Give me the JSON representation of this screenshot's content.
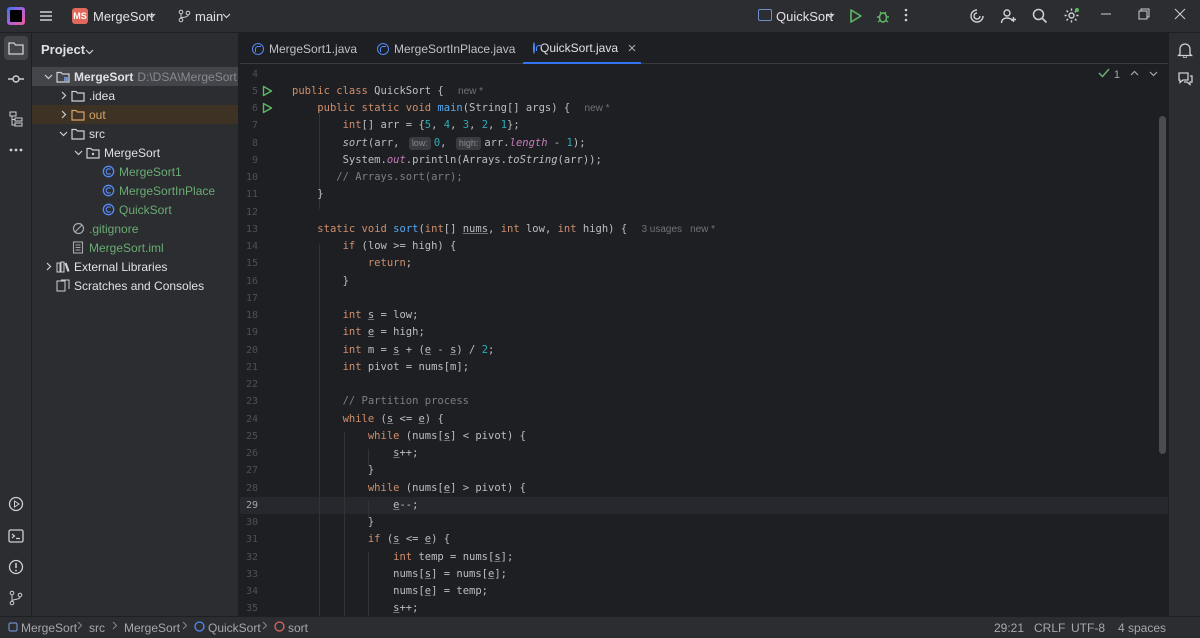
{
  "titlebar": {
    "project_badge": "MS",
    "project_name": "MergeSort",
    "branch": "main",
    "run_config": "QuickSort"
  },
  "project_panel": {
    "title": "Project",
    "tree": [
      {
        "label": "MergeSort",
        "path": "D:\\DSA\\MergeSort",
        "depth": 0,
        "arrow": "down",
        "icon": "module-folder-icon",
        "style": "bold",
        "selected": true
      },
      {
        "label": ".idea",
        "depth": 1,
        "arrow": "right",
        "icon": "folder-icon"
      },
      {
        "label": "out",
        "depth": 1,
        "arrow": "right",
        "icon": "folder-orange-icon",
        "style": "orange",
        "excluded": true
      },
      {
        "label": "src",
        "depth": 1,
        "arrow": "down",
        "icon": "folder-icon"
      },
      {
        "label": "MergeSort",
        "depth": 2,
        "arrow": "down",
        "icon": "package-icon"
      },
      {
        "label": "MergeSort1",
        "depth": 3,
        "icon": "class-icon",
        "style": "green"
      },
      {
        "label": "MergeSortInPlace",
        "depth": 3,
        "icon": "class-icon",
        "style": "green"
      },
      {
        "label": "QuickSort",
        "depth": 3,
        "icon": "class-icon",
        "style": "green"
      },
      {
        "label": ".gitignore",
        "depth": 1,
        "icon": "ignore-file-icon",
        "style": "green"
      },
      {
        "label": "MergeSort.iml",
        "depth": 1,
        "icon": "iml-file-icon",
        "style": "green"
      },
      {
        "label": "External Libraries",
        "depth": 0,
        "arrow": "right",
        "icon": "library-icon"
      },
      {
        "label": "Scratches and Consoles",
        "depth": 0,
        "icon": "scratches-icon"
      }
    ]
  },
  "editor_tabs": [
    {
      "label": "MergeSort1.java",
      "active": false
    },
    {
      "label": "MergeSortInPlace.java",
      "active": false
    },
    {
      "label": "QuickSort.java",
      "active": true
    }
  ],
  "editor": {
    "inspection_count": "1",
    "current_line": 29,
    "lines": [
      {
        "n": 4,
        "html": ""
      },
      {
        "n": 5,
        "run": true,
        "html": "<span class=\"kw\">public class</span> QuickSort { <span class=\"meta\">new *</span>"
      },
      {
        "n": 6,
        "run": true,
        "html": "    <span class=\"kw\">public static void</span> <span class=\"fn\">main</span>(String[] args) { <span class=\"meta\">new *</span>"
      },
      {
        "n": 7,
        "html": "        <span class=\"kw\">int</span>[] arr = {<span class=\"num\">5</span>, <span class=\"num\">4</span>, <span class=\"num\">3</span>, <span class=\"num\">2</span>, <span class=\"num\">1</span>};"
      },
      {
        "n": 8,
        "html": "        <span class=\"it\">sort</span>(arr, <span class=\"hint\">low:</span><span class=\"num\">0</span>, <span class=\"hint\">high:</span>arr.<span class=\"st\">length</span> - <span class=\"num\">1</span>);"
      },
      {
        "n": 9,
        "html": "        System.<span class=\"st\">out</span>.println(Arrays.<span class=\"it\">toString</span>(arr));"
      },
      {
        "n": 10,
        "html": "       <span class=\"cm\">// Arrays.sort(arr);</span>"
      },
      {
        "n": 11,
        "html": "    }"
      },
      {
        "n": 12,
        "html": ""
      },
      {
        "n": 13,
        "html": "    <span class=\"kw\">static void</span> <span class=\"fn\">sort</span>(<span class=\"kw\">int</span>[] <span class=\"ul\">nums</span>, <span class=\"kw\">int</span> low, <span class=\"kw\">int</span> high) { <span class=\"meta\">3 usages</span><span class=\"meta\">new *</span>"
      },
      {
        "n": 14,
        "html": "        <span class=\"kw\">if</span> (low &gt;= high) {"
      },
      {
        "n": 15,
        "html": "            <span class=\"kw\">return</span>;"
      },
      {
        "n": 16,
        "html": "        }"
      },
      {
        "n": 17,
        "html": ""
      },
      {
        "n": 18,
        "html": "        <span class=\"kw\">int</span> <span class=\"ul\">s</span> = low;"
      },
      {
        "n": 19,
        "html": "        <span class=\"kw\">int</span> <span class=\"ul\">e</span> = high;"
      },
      {
        "n": 20,
        "html": "        <span class=\"kw\">int</span> m = <span class=\"ul\">s</span> + (<span class=\"ul\">e</span> - <span class=\"ul\">s</span>) / <span class=\"num\">2</span>;"
      },
      {
        "n": 21,
        "html": "        <span class=\"kw\">int</span> pivot = nums[m];"
      },
      {
        "n": 22,
        "html": ""
      },
      {
        "n": 23,
        "html": "        <span class=\"cm\">// Partition process</span>"
      },
      {
        "n": 24,
        "html": "        <span class=\"kw\">while</span> (<span class=\"ul\">s</span> &lt;= <span class=\"ul\">e</span>) {"
      },
      {
        "n": 25,
        "html": "            <span class=\"kw\">while</span> (nums[<span class=\"ul\">s</span>] &lt; pivot) {"
      },
      {
        "n": 26,
        "html": "                <span class=\"ul\">s</span>++;"
      },
      {
        "n": 27,
        "html": "            }"
      },
      {
        "n": 28,
        "html": "            <span class=\"kw\">while</span> (nums[<span class=\"ul\">e</span>] &gt; pivot) {"
      },
      {
        "n": 29,
        "html": "                <span class=\"ul\">e</span>--;"
      },
      {
        "n": 30,
        "html": "            }"
      },
      {
        "n": 31,
        "html": "            <span class=\"kw\">if</span> (<span class=\"ul\">s</span> &lt;= <span class=\"ul\">e</span>) {"
      },
      {
        "n": 32,
        "html": "                <span class=\"kw\">int</span> temp = nums[<span class=\"ul\">s</span>];"
      },
      {
        "n": 33,
        "html": "                nums[<span class=\"ul\">s</span>] = nums[<span class=\"ul\">e</span>];"
      },
      {
        "n": 34,
        "html": "                nums[<span class=\"ul\">e</span>] = temp;"
      },
      {
        "n": 35,
        "html": "                <span class=\"ul\">s</span>++;"
      }
    ]
  },
  "status_bar": {
    "breadcrumbs": [
      "MergeSort",
      "src",
      "MergeSort",
      "QuickSort",
      "sort"
    ],
    "position": "29:21",
    "line_separator": "CRLF",
    "encoding": "UTF-8",
    "indent": "4 spaces"
  },
  "colors": {
    "accent": "#3574f0",
    "background": "#1e1f22",
    "panel": "#2b2d30"
  }
}
